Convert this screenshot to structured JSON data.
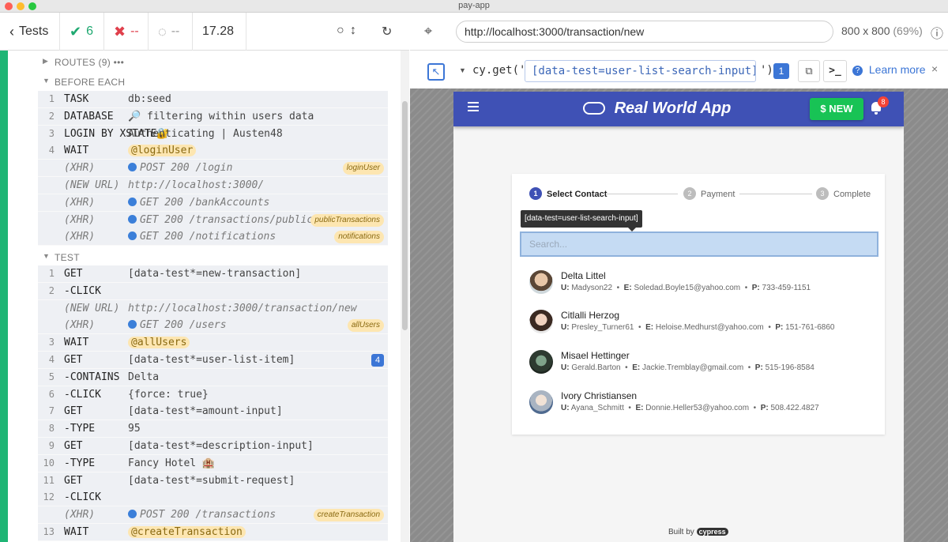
{
  "window": {
    "title": "pay-app"
  },
  "runner": {
    "tests_label": "Tests",
    "passed": "6",
    "failed": "--",
    "pending": "--",
    "duration": "17.28",
    "routes_label": "ROUTES (9)",
    "routes_more": "•••",
    "before_each_label": "BEFORE EACH",
    "test_label": "TEST"
  },
  "before_each": [
    {
      "num": "1",
      "name": "TASK",
      "msg": "db:seed"
    },
    {
      "num": "2",
      "name": "DATABASE",
      "msg": "🔎 filtering within users data"
    },
    {
      "num": "3",
      "name": "LOGIN BY XSTATE🔐",
      "msg": "Authenticating | Austen48"
    },
    {
      "num": "4",
      "name": "WAIT",
      "msg": "@loginUser"
    },
    {
      "num": "",
      "name": "(XHR)",
      "msg": "POST 200 /login",
      "tag": "loginUser"
    },
    {
      "num": "",
      "name": "(NEW URL)",
      "msg": "http://localhost:3000/"
    },
    {
      "num": "",
      "name": "(XHR)",
      "msg": "GET 200 /bankAccounts"
    },
    {
      "num": "",
      "name": "(XHR)",
      "msg": "GET 200 /transactions/public",
      "tag": "publicTransactions"
    },
    {
      "num": "",
      "name": "(XHR)",
      "msg": "GET 200 /notifications",
      "tag": "notifications"
    }
  ],
  "test_cmds": [
    {
      "num": "1",
      "name": "GET",
      "msg": "[data-test*=new-transaction]"
    },
    {
      "num": "2",
      "name": "-CLICK",
      "msg": ""
    },
    {
      "num": "",
      "name": "(NEW URL)",
      "msg": "http://localhost:3000/transaction/new"
    },
    {
      "num": "",
      "name": "(XHR)",
      "msg": "GET 200 /users",
      "tag": "allUsers"
    },
    {
      "num": "3",
      "name": "WAIT",
      "msg": "@allUsers"
    },
    {
      "num": "4",
      "name": "GET",
      "msg": "[data-test*=user-list-item]",
      "badge": "4"
    },
    {
      "num": "5",
      "name": "-CONTAINS",
      "msg": "Delta"
    },
    {
      "num": "6",
      "name": "-CLICK",
      "msg": "{force: true}"
    },
    {
      "num": "7",
      "name": "GET",
      "msg": "[data-test*=amount-input]"
    },
    {
      "num": "8",
      "name": "-TYPE",
      "msg": "95"
    },
    {
      "num": "9",
      "name": "GET",
      "msg": "[data-test*=description-input]"
    },
    {
      "num": "10",
      "name": "-TYPE",
      "msg": "Fancy Hotel 🏨"
    },
    {
      "num": "11",
      "name": "GET",
      "msg": "[data-test*=submit-request]"
    },
    {
      "num": "12",
      "name": "-CLICK",
      "msg": ""
    },
    {
      "num": "",
      "name": "(XHR)",
      "msg": "POST 200 /transactions",
      "tag": "createTransaction"
    },
    {
      "num": "13",
      "name": "WAIT",
      "msg": "@createTransaction"
    }
  ],
  "browser": {
    "url": "http://localhost:3000/transaction/new",
    "viewport": "800 x 800",
    "zoom": "(69%)",
    "selector_prefix": "cy.get('",
    "selector_value": "[data-test=user-list-search-input]",
    "selector_suffix": "')",
    "selector_count": "1",
    "console_label": ">_",
    "learn_more": "Learn more"
  },
  "app": {
    "brand": "Real World App",
    "new_button": "$ NEW",
    "notif_count": "8",
    "steps": [
      "Select Contact",
      "Payment",
      "Complete"
    ],
    "step_nums": [
      "1",
      "2",
      "3"
    ],
    "tooltip": "[data-test=user-list-search-input]",
    "search_placeholder": "Search...",
    "users": [
      {
        "name": "Delta Littel",
        "u": "Madyson22",
        "e": "Soledad.Boyle15@yahoo.com",
        "p": "733-459-1151"
      },
      {
        "name": "Citlalli Herzog",
        "u": "Presley_Turner61",
        "e": "Heloise.Medhurst@yahoo.com",
        "p": "151-761-6860"
      },
      {
        "name": "Misael Hettinger",
        "u": "Gerald.Barton",
        "e": "Jackie.Tremblay@gmail.com",
        "p": "515-196-8584"
      },
      {
        "name": "Ivory Christiansen",
        "u": "Ayana_Schmitt",
        "e": "Donnie.Heller53@yahoo.com",
        "p": "508.422.4827"
      }
    ],
    "built_by": "Built by",
    "built_by_brand": "cypress"
  },
  "colors": {
    "pass": "#1fa971",
    "fail": "#e0404c",
    "accent": "#3c76d6",
    "appbar": "#3f51b5",
    "new": "#18c355"
  }
}
